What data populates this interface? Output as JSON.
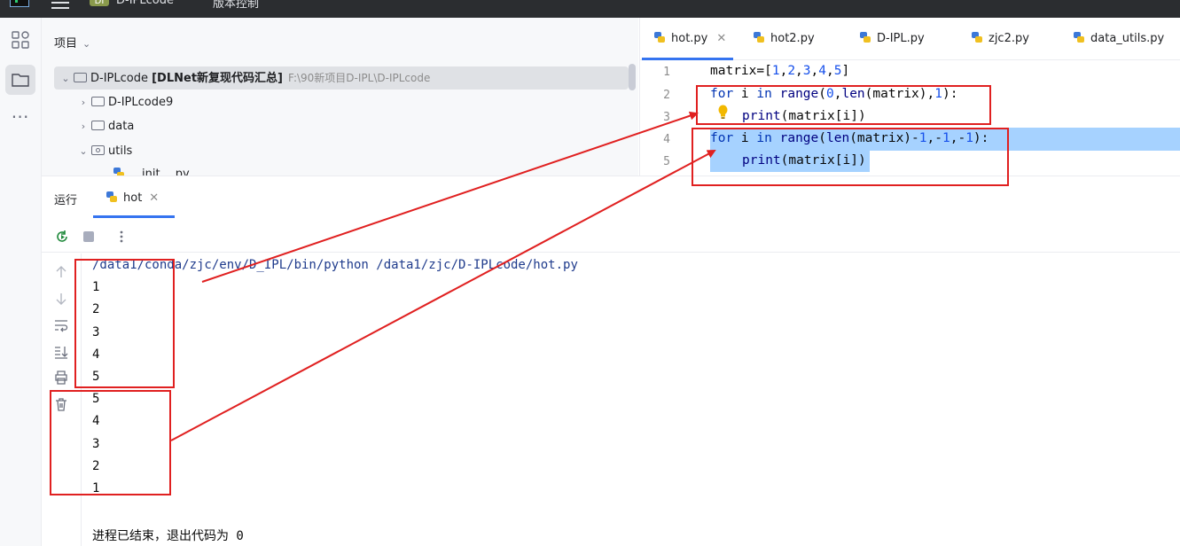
{
  "titlebar": {
    "project_badge": "DI",
    "project_name": "D-IPLcode",
    "vcs_label": "版本控制"
  },
  "project_panel": {
    "header": "项目",
    "root": {
      "name": "D-IPLcode",
      "bold": "[DLNet新复现代码汇总]",
      "path": "F:\\90新项目D-IPL\\D-IPLcode"
    },
    "items": [
      {
        "label": "D-IPLcode9"
      },
      {
        "label": "data"
      },
      {
        "label": "utils"
      },
      {
        "label": "__init__.py"
      }
    ]
  },
  "editor": {
    "tabs": [
      {
        "label": "hot.py",
        "active": true
      },
      {
        "label": "hot2.py"
      },
      {
        "label": "D-IPL.py"
      },
      {
        "label": "zjc2.py"
      },
      {
        "label": "data_utils.py"
      }
    ],
    "line_numbers": [
      "1",
      "2",
      "3",
      "4",
      "5"
    ],
    "code": {
      "l1_a": "matrix=[",
      "l1_n1": "1",
      "l1_n2": "2",
      "l1_n3": "3",
      "l1_n4": "4",
      "l1_n5": "5",
      "comma": ",",
      "l1_end": "]",
      "kw_for": "for",
      "kw_in": "in",
      "var_i": " i ",
      "fn_range": "range",
      "fn_len": "len",
      "fn_print": "print",
      "l2_arg_a": "(",
      "l2_zero": "0",
      "l2_mid": ",",
      "l2_mat": "(matrix),",
      "l2_one": "1",
      "l2_end": "):",
      "l3_arg": "(matrix[i])",
      "l4_open": "(",
      "l4_mat": "(matrix)-",
      "l4_m1a": "1",
      "l4_c1": ",-",
      "l4_m1b": "1",
      "l4_c2": ",-",
      "l4_m1c": "1",
      "l4_end": "):",
      "l5_arg": "(matrix[i])"
    }
  },
  "run_panel": {
    "title": "运行",
    "tab_label": "hot",
    "command": "/data1/conda/zjc/env/D_IPL/bin/python /data1/zjc/D-IPLcode/hot.py",
    "output": [
      "1",
      "2",
      "3",
      "4",
      "5",
      "5",
      "4",
      "3",
      "2",
      "1"
    ],
    "exit_message": "进程已结束，退出代码为 0"
  },
  "colors": {
    "accent": "#3574f0",
    "selection": "#a6d2ff",
    "annotation_red": "#e02020",
    "keyword": "#0033b3",
    "number": "#1750eb"
  }
}
